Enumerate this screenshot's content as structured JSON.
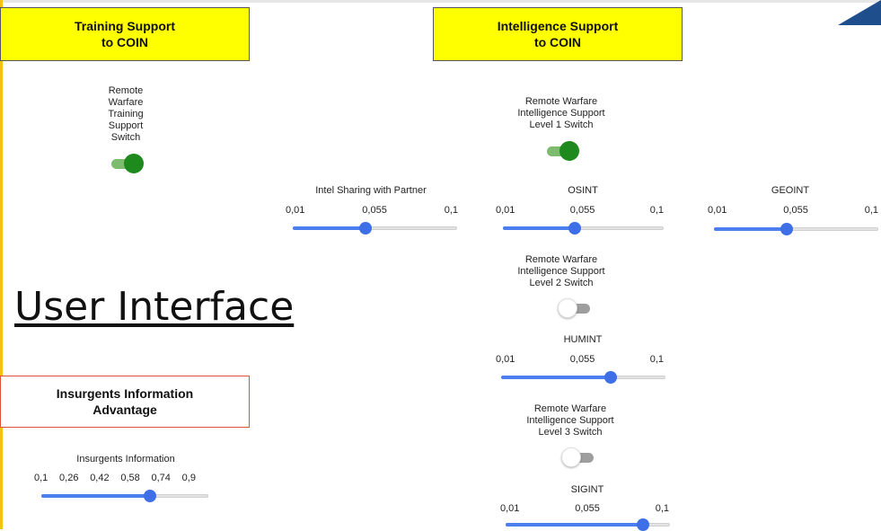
{
  "headers": {
    "training": "Training Support\nto COIN",
    "intelligence": "Intelligence Support\nto COIN",
    "insurgents": "Insurgents Information\nAdvantage"
  },
  "page_title": "User Interface",
  "switches": {
    "training": {
      "label": "Remote\nWarfare\nTraining\nSupport\nSwitch",
      "state": "on"
    },
    "level1": {
      "label": "Remote Warfare\nIntelligence Support\nLevel 1 Switch",
      "state": "on"
    },
    "level2": {
      "label": "Remote Warfare\nIntelligence Support\nLevel 2 Switch",
      "state": "off"
    },
    "level3": {
      "label": "Remote Warfare\nIntelligence Support\nLevel 3 Switch",
      "state": "off"
    }
  },
  "sliders": {
    "intel_sharing": {
      "label": "Intel Sharing with Partner",
      "ticks": [
        "0,01",
        "0,055",
        "0,1"
      ],
      "value": 0.05
    },
    "osint": {
      "label": "OSINT",
      "ticks": [
        "0,01",
        "0,055",
        "0,1"
      ],
      "value": 0.05
    },
    "geoint": {
      "label": "GEOINT",
      "ticks": [
        "0,01",
        "0,055",
        "0,1"
      ],
      "value": 0.05
    },
    "humint": {
      "label": "HUMINT",
      "ticks": [
        "0,01",
        "0,055",
        "0,1"
      ],
      "value": 0.07
    },
    "sigint": {
      "label": "SIGINT",
      "ticks": [
        "0,01",
        "0,055",
        "0,1"
      ],
      "value": 0.085
    },
    "insurgents_info": {
      "label": "Insurgents Information",
      "ticks": [
        "0,1",
        "0,26",
        "0,42",
        "0,58",
        "0,74",
        "0,9"
      ],
      "value": 0.62
    }
  },
  "colors": {
    "accent": "#4d7ef0",
    "switch_on": "#1e8a1e",
    "header_bg": "#ffff00"
  }
}
